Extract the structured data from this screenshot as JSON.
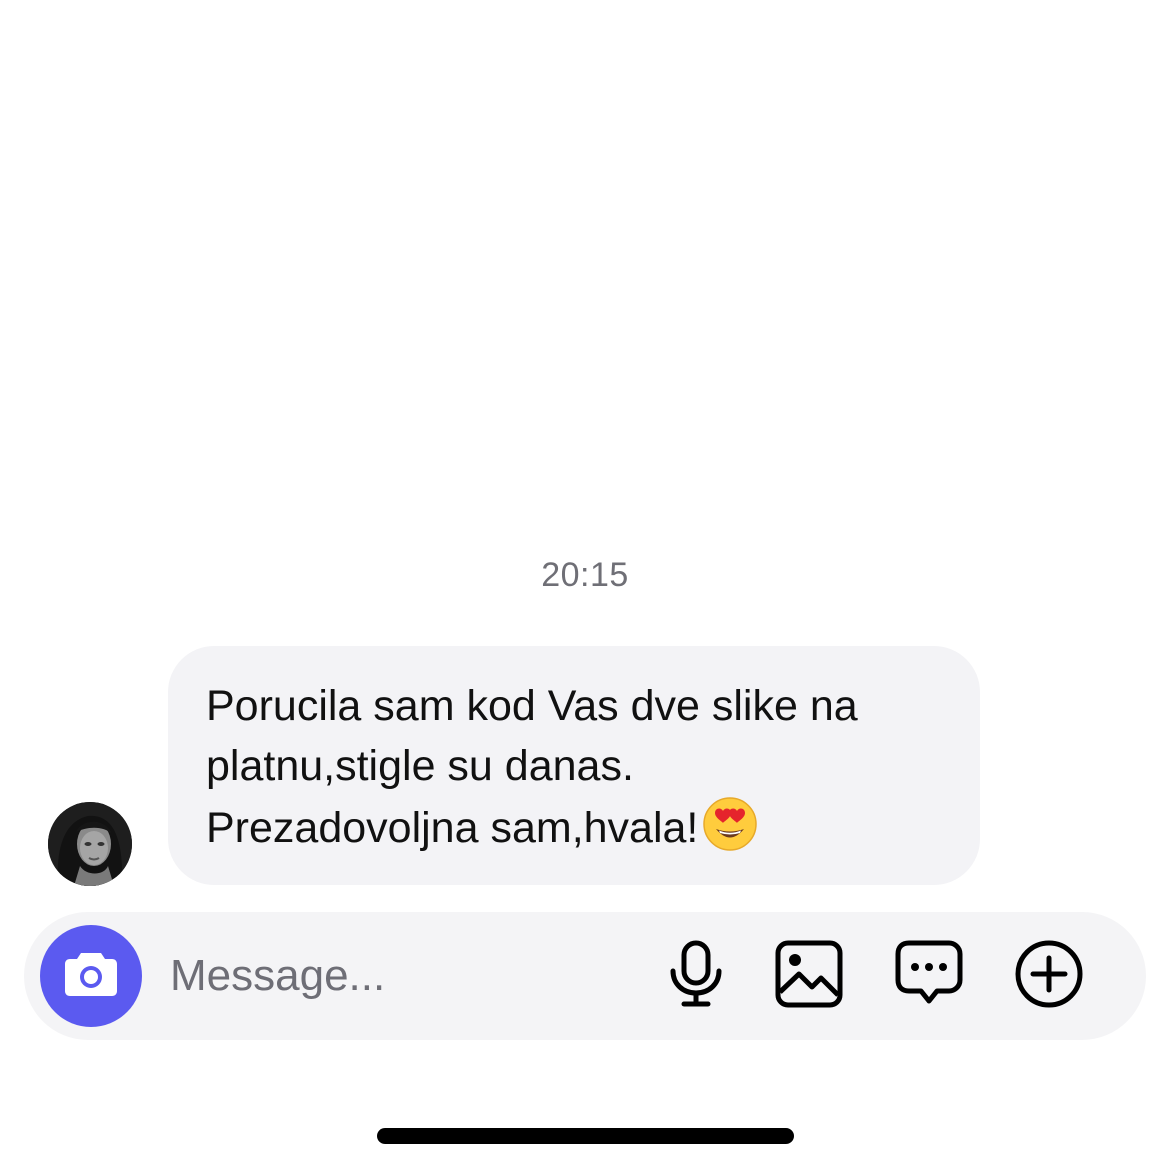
{
  "conversation": {
    "timestamp": "20:15",
    "messages": [
      {
        "sender": "incoming",
        "lines": [
          "Porucila sam kod Vas dve slike na",
          "platnu,stigle su danas.",
          "Prezadovoljna sam,hvala!"
        ],
        "emoji": "smiling-face-with-heart-eyes-icon"
      }
    ]
  },
  "composer": {
    "placeholder": "Message...",
    "value": "",
    "icons": {
      "camera": "camera-icon",
      "microphone": "microphone-icon",
      "gallery": "gallery-icon",
      "sticker": "chat-bubble-icon",
      "add": "plus-circle-icon"
    },
    "accent_color": "#5b5af0"
  }
}
